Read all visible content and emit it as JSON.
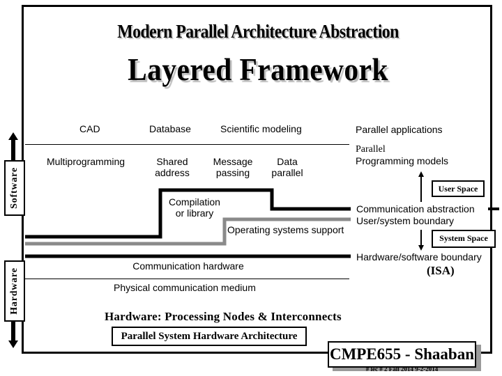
{
  "slide": {
    "title": "Modern Parallel Architecture Abstraction",
    "subtitle": "Layered Framework"
  },
  "side_labels": {
    "software": "Software",
    "hardware": "Hardware"
  },
  "layers": {
    "applications": {
      "items": [
        "CAD",
        "Database",
        "Scientific modeling"
      ],
      "label": "Parallel applications"
    },
    "programming_models": {
      "items": [
        {
          "line1": "Multiprogramming",
          "line2": ""
        },
        {
          "line1": "Shared",
          "line2": "address"
        },
        {
          "line1": "Message",
          "line2": "passing"
        },
        {
          "line1": "Data",
          "line2": "parallel"
        }
      ],
      "label_line1": "Parallel",
      "label_line2": "Programming models"
    },
    "compilation": {
      "line1": "Compilation",
      "line2": "or library"
    },
    "os_support": "Operating systems support",
    "communication_abstraction": "Communication abstraction",
    "user_system_boundary": "User/system boundary",
    "hw_sw_boundary": "Hardware/software boundary",
    "isa": "(ISA)",
    "communication_hardware": "Communication hardware",
    "physical_medium": "Physical communication medium"
  },
  "tags": {
    "user_space": "User Space",
    "system_space": "System Space"
  },
  "hardware_caption": "Hardware:  Processing Nodes & Interconnects",
  "footer_box": "Parallel System Hardware Architecture",
  "brand": {
    "title": "CMPE655 - Shaaban",
    "subline": "#  lec # 2    Fall 2014   9-2-2014"
  },
  "colors": {
    "line": "#000000",
    "os_line": "#8a8a8a",
    "shadow": "#bdbdbd"
  }
}
